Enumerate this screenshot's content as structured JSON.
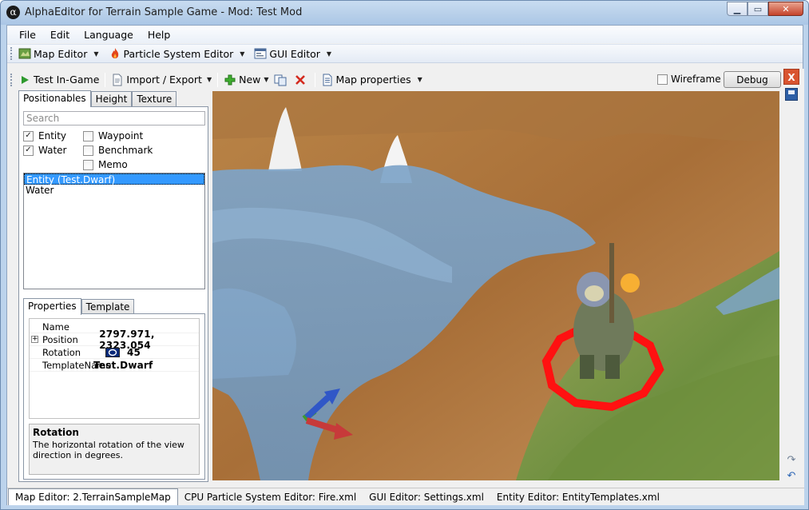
{
  "window": {
    "title": "AlphaEditor for Terrain Sample Game - Mod: Test Mod",
    "app_icon_glyph": "α",
    "buttons": {
      "minimize": "▁",
      "maximize": "▭",
      "close": "✕"
    }
  },
  "menubar": {
    "items": [
      "File",
      "Edit",
      "Language",
      "Help"
    ]
  },
  "toolbar": {
    "items": [
      {
        "label": "Map Editor",
        "icon": "map-editor-icon"
      },
      {
        "label": "Particle System Editor",
        "icon": "fire-icon"
      },
      {
        "label": "GUI Editor",
        "icon": "gui-editor-icon"
      }
    ]
  },
  "map_toolbar": {
    "test_ingame": "Test In-Game",
    "import_export": "Import / Export",
    "new": "New",
    "map_properties": "Map properties",
    "wireframe_label": "Wireframe",
    "wireframe_checked": false,
    "debug": "Debug",
    "close_glyph": "X"
  },
  "left_panel": {
    "tabs": [
      "Positionables",
      "Height",
      "Texture"
    ],
    "active_tab": "Positionables",
    "search_placeholder": "Search",
    "filters": [
      {
        "label": "Entity",
        "checked": true
      },
      {
        "label": "Water",
        "checked": true
      },
      {
        "label": "Waypoint",
        "checked": false
      },
      {
        "label": "Benchmark",
        "checked": false
      },
      {
        "label": "Memo",
        "checked": false
      }
    ],
    "list": [
      "Entity (Test.Dwarf)",
      "Water"
    ],
    "selected_index": 0,
    "sub_tabs": [
      "Properties",
      "Template"
    ],
    "properties": [
      {
        "name": "Name",
        "value": ""
      },
      {
        "name": "Position",
        "value": "2797.971, 2323.054"
      },
      {
        "name": "Rotation",
        "value": "45"
      },
      {
        "name": "TemplateName",
        "value": "Test.Dwarf"
      }
    ],
    "description": {
      "title": "Rotation",
      "text": "The horizontal rotation of the view direction in degrees."
    }
  },
  "status_tabs": [
    "Map Editor: 2.TerrainSampleMap",
    "CPU Particle System Editor: Fire.xml",
    "GUI Editor: Settings.xml",
    "Entity Editor: EntityTemplates.xml"
  ],
  "colors": {
    "accent": "#3399ff",
    "selection_ring": "#ff0000",
    "water": "#7ea4c8",
    "terrain_sand": "#c08b52",
    "grass": "#7f9a4a"
  }
}
